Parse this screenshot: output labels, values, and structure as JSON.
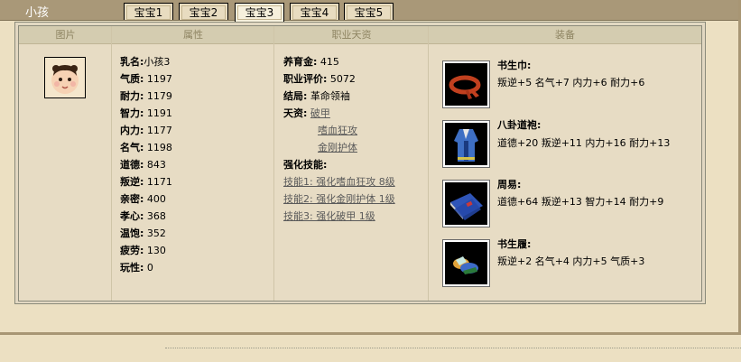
{
  "window": {
    "title": "小孩"
  },
  "tabs": [
    {
      "label": "宝宝1",
      "active": false
    },
    {
      "label": "宝宝2",
      "active": false
    },
    {
      "label": "宝宝3",
      "active": true
    },
    {
      "label": "宝宝4",
      "active": false
    },
    {
      "label": "宝宝5",
      "active": false
    }
  ],
  "headers": {
    "picture": "图片",
    "attributes": "属性",
    "talent": "职业天资",
    "equipment": "装备"
  },
  "attributes": [
    {
      "label": "乳名:",
      "value": "小孩3"
    },
    {
      "label": "气质:",
      "value": "1197"
    },
    {
      "label": "耐力:",
      "value": "1179"
    },
    {
      "label": "智力:",
      "value": "1191"
    },
    {
      "label": "内力:",
      "value": "1177"
    },
    {
      "label": "名气:",
      "value": "1198"
    },
    {
      "label": "道德:",
      "value": "843"
    },
    {
      "label": "叛逆:",
      "value": "1171"
    },
    {
      "label": "亲密:",
      "value": "400"
    },
    {
      "label": "孝心:",
      "value": "368"
    },
    {
      "label": "温饱:",
      "value": "352"
    },
    {
      "label": "疲劳:",
      "value": "130"
    },
    {
      "label": "玩性:",
      "value": "0"
    }
  ],
  "talent": {
    "fee_label": "养育金:",
    "fee_value": "415",
    "eval_label": "职业评价:",
    "eval_value": "5072",
    "ending_label": "结局:",
    "ending_value": "革命领袖",
    "talents_label": "天资:",
    "talents": [
      "破甲",
      "嗜血狂攻",
      "金刚护体"
    ],
    "skills_label": "强化技能:",
    "skills": [
      "技能1: 强化嗜血狂攻 8级",
      "技能2: 强化金刚护体 1级",
      "技能3: 强化破甲 1级"
    ]
  },
  "equipment": [
    {
      "name": "书生巾:",
      "stats": "叛逆+5 名气+7 内力+6 耐力+6",
      "icon": "scarf-icon"
    },
    {
      "name": "八卦道袍:",
      "stats": "道德+20 叛逆+11 内力+16 耐力+13",
      "icon": "robe-icon"
    },
    {
      "name": "周易:",
      "stats": "道德+64 叛逆+13 智力+14 耐力+9",
      "icon": "book-icon"
    },
    {
      "name": "书生履:",
      "stats": "叛逆+2 名气+4 内力+5 气质+3",
      "icon": "shoes-icon"
    }
  ]
}
